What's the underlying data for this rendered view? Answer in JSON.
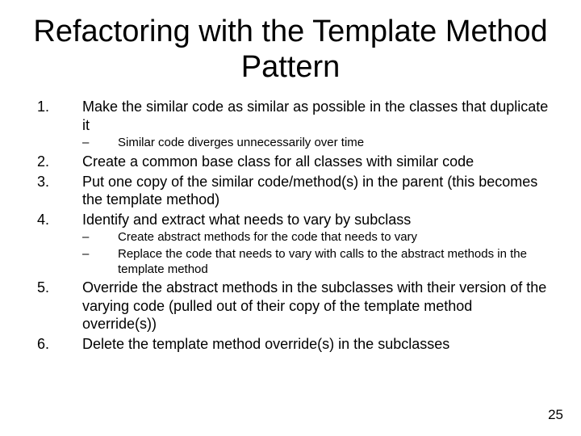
{
  "title": "Refactoring with the Template Method Pattern",
  "items": [
    {
      "n": "1.",
      "text": "Make the similar code as similar as possible in the classes that duplicate it"
    },
    {
      "n": "2.",
      "text": "Create a common base class for all classes with similar code"
    },
    {
      "n": "3.",
      "text": "Put one copy of the similar code/method(s) in the parent (this becomes the template method)"
    },
    {
      "n": "4.",
      "text": "Identify and extract what needs to vary by subclass"
    },
    {
      "n": "5.",
      "text": "Override the abstract methods in the subclasses with their version of the varying code (pulled out of their copy of the template method override(s))"
    },
    {
      "n": "6.",
      "text": "Delete the template method override(s) in the subclasses"
    }
  ],
  "sub1": [
    {
      "d": "–",
      "text": "Similar code diverges unnecessarily over time"
    }
  ],
  "sub4": [
    {
      "d": "–",
      "text": "Create abstract methods for the code that needs to vary"
    },
    {
      "d": "–",
      "text": "Replace the code that needs to vary with calls to the abstract methods in the template method"
    }
  ],
  "page_number": "25"
}
